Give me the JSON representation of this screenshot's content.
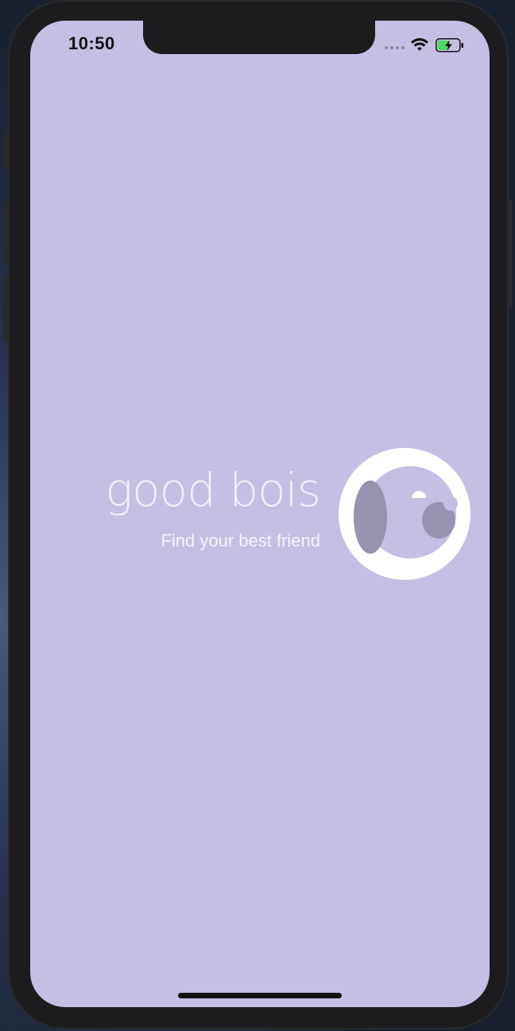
{
  "status_bar": {
    "time": "10:50",
    "signal_icon": "cellular-signal-icon",
    "wifi_icon": "wifi-icon",
    "battery_icon": "battery-charging-icon"
  },
  "splash": {
    "brand_name": "good bois",
    "tagline": "Find your best friend",
    "logo_icon": "dog-face-logo-icon"
  },
  "colors": {
    "screen_background": "#c5bfe4",
    "brand_text": "#f1eff7",
    "logo_ring": "#ffffff",
    "logo_accent": "#9891b0",
    "battery_fill": "#4cd964"
  }
}
